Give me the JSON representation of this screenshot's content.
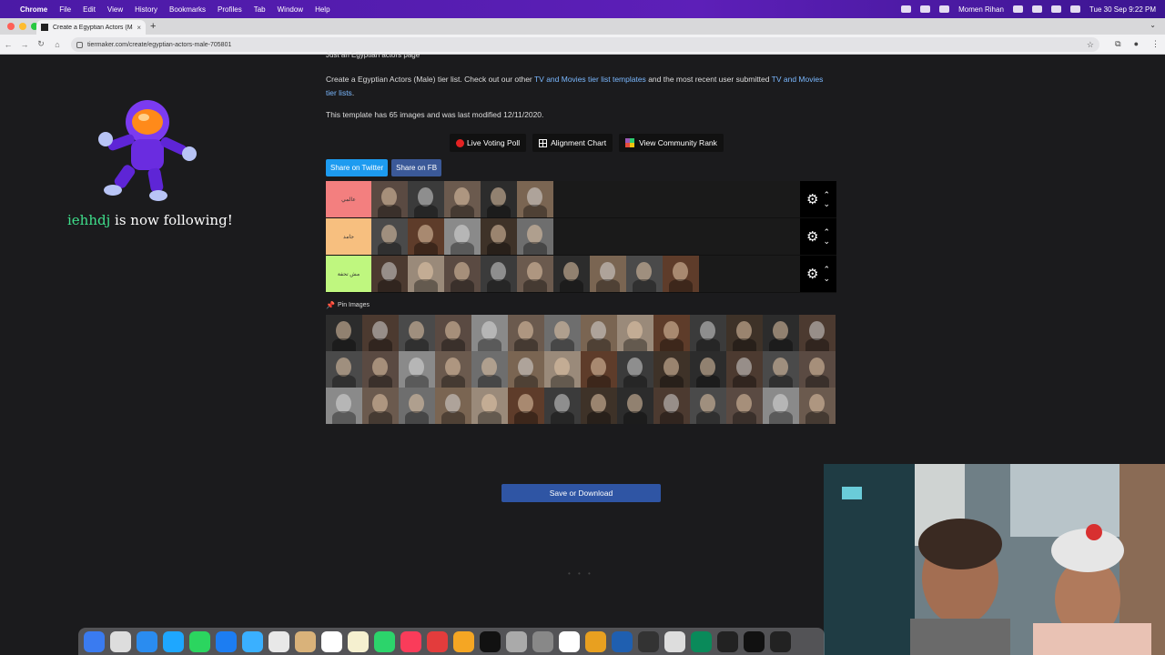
{
  "menubar": {
    "app": "Chrome",
    "items": [
      "File",
      "Edit",
      "View",
      "History",
      "Bookmarks",
      "Profiles",
      "Tab",
      "Window",
      "Help"
    ],
    "user": "Momen Rihan",
    "datetime": "Tue 30 Sep  9:22 PM"
  },
  "browser": {
    "tab_title": "Create a Egyptian Actors (Ma",
    "url": "tiermaker.com/create/egyptian-actors-male-705801"
  },
  "page": {
    "intro_cut": "Just an Egyptian actors page",
    "intro_text": "Create a Egyptian Actors (Male) tier list. Check out our other",
    "intro_link1": "TV and Movies tier list templates",
    "intro_mid": "and the most recent user submitted",
    "intro_link2": "TV and Movies tier lists",
    "intro_end": ".",
    "meta": "This template has 65 images and was last modified 12/11/2020.",
    "buttons": {
      "live_poll": "Live Voting Poll",
      "alignment": "Alignment Chart",
      "community": "View Community Rank",
      "twitter": "Share on Twitter",
      "facebook": "Share on FB",
      "save": "Save or Download"
    },
    "pin_label": "Pin Images",
    "loading": "• • •"
  },
  "tiers": [
    {
      "label": "عالمي",
      "color": "#f37f7f",
      "count": 5
    },
    {
      "label": "جامد",
      "color": "#f7bf7f",
      "count": 5
    },
    {
      "label": "مش تحفة",
      "color": "#bff77f",
      "count": 9
    }
  ],
  "pool_count": 42,
  "notification": {
    "user": "iehhdj",
    "text": " is now following!"
  },
  "colors": {
    "twitter": "#1d9bf0",
    "facebook": "#3b5998",
    "save": "#2f55a4",
    "notification_user": "#3fe08c"
  }
}
